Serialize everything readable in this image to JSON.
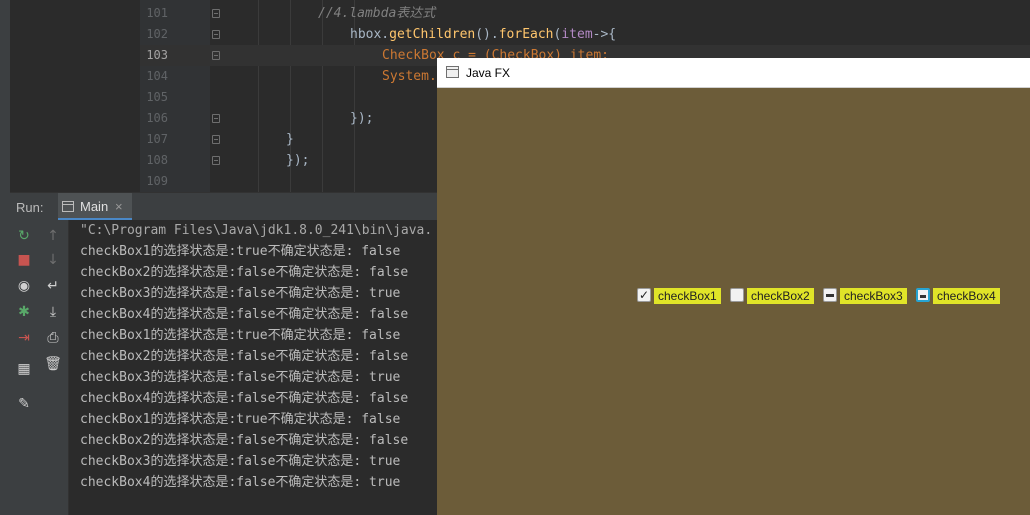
{
  "editor": {
    "lines": [
      {
        "num": "101",
        "code": [
          {
            "t": "//4.lambda表达式",
            "c": "c-comment"
          }
        ],
        "indent": 318
      },
      {
        "num": "102",
        "code": [
          {
            "t": "hbox.",
            "c": "c-call"
          },
          {
            "t": "getChildren",
            "c": "c-method"
          },
          {
            "t": "().",
            "c": "c-call"
          },
          {
            "t": "forEach",
            "c": "c-method"
          },
          {
            "t": "(",
            "c": "c-call"
          },
          {
            "t": "item",
            "c": "c-param"
          },
          {
            "t": "->{",
            "c": "c-call"
          }
        ],
        "indent": 350
      },
      {
        "num": "103",
        "code": [
          {
            "t": "CheckBox c = (CheckBox) item;",
            "c": "c-type"
          }
        ],
        "indent": 382
      },
      {
        "num": "104",
        "code": [
          {
            "t": "System.",
            "c": "c-type"
          }
        ],
        "indent": 382
      },
      {
        "num": "105",
        "code": [],
        "indent": 382
      },
      {
        "num": "106",
        "code": [
          {
            "t": "});",
            "c": "c-call"
          }
        ],
        "indent": 350
      },
      {
        "num": "107",
        "code": [
          {
            "t": "}",
            "c": "c-call"
          }
        ],
        "indent": 286
      },
      {
        "num": "108",
        "code": [
          {
            "t": "});",
            "c": "c-call"
          }
        ],
        "indent": 286
      },
      {
        "num": "109",
        "code": [],
        "indent": 286
      }
    ],
    "current_line": "103"
  },
  "run_panel": {
    "label": "Run:",
    "tab_label": "Main",
    "tab_close": "×",
    "tools": [
      {
        "name": "rerun-icon",
        "glyph": "↻",
        "color": "#59a869"
      },
      {
        "name": "stop-icon",
        "glyph": "■",
        "color": "#c75450"
      },
      {
        "name": "camera-icon",
        "glyph": "◉",
        "color": "#d0d0d0"
      },
      {
        "name": "debug-icon",
        "glyph": "✱",
        "color": "#59a869"
      },
      {
        "name": "exit-icon",
        "glyph": "⇥",
        "color": "#c75450"
      },
      {
        "name": "layout-icon",
        "glyph": "▦",
        "color": "#d0d0d0"
      },
      {
        "name": "pin-icon",
        "glyph": "✎",
        "color": "#d0d0d0"
      }
    ],
    "tools2": [
      {
        "name": "up-arrow-icon",
        "glyph": "↑",
        "color": "#6e6e6e"
      },
      {
        "name": "down-arrow-icon",
        "glyph": "↓",
        "color": "#6e6e6e"
      },
      {
        "name": "soft-wrap-icon",
        "glyph": "↵",
        "color": "#d0d0d0"
      },
      {
        "name": "scroll-to-end-icon",
        "glyph": "⤓",
        "color": "#d0d0d0"
      },
      {
        "name": "print-icon",
        "glyph": "⎙",
        "color": "#d0d0d0"
      },
      {
        "name": "trash-icon",
        "glyph": "🗑",
        "color": "#d0d0d0"
      }
    ],
    "console": [
      "\"C:\\Program Files\\Java\\jdk1.8.0_241\\bin\\java.",
      "checkBox1的选择状态是:true不确定状态是: false",
      "checkBox2的选择状态是:false不确定状态是: false",
      "checkBox3的选择状态是:false不确定状态是: true",
      "checkBox4的选择状态是:false不确定状态是: false",
      "checkBox1的选择状态是:true不确定状态是: false",
      "checkBox2的选择状态是:false不确定状态是: false",
      "checkBox3的选择状态是:false不确定状态是: true",
      "checkBox4的选择状态是:false不确定状态是: false",
      "checkBox1的选择状态是:true不确定状态是: false",
      "checkBox2的选择状态是:false不确定状态是: false",
      "checkBox3的选择状态是:false不确定状态是: true",
      "checkBox4的选择状态是:false不确定状态是: true"
    ]
  },
  "fx_window": {
    "title": "Java FX",
    "background": "#6c5c39",
    "label_background": "#e0e428",
    "checkboxes": [
      {
        "label": "checkBox1",
        "state": "checked"
      },
      {
        "label": "checkBox2",
        "state": "unchecked"
      },
      {
        "label": "checkBox3",
        "state": "indeterminate"
      },
      {
        "label": "checkBox4",
        "state": "indeterminate-focused"
      }
    ]
  }
}
